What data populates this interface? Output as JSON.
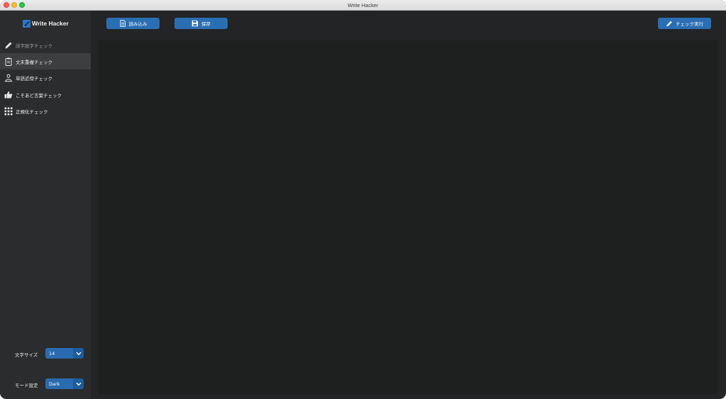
{
  "window": {
    "title": "Write Hacker"
  },
  "app": {
    "logo_text": "Write Hacker"
  },
  "sidebar": {
    "items": [
      {
        "label": "誤字脱字チェック",
        "icon": "pencil-icon",
        "state": "dimmed"
      },
      {
        "label": "文末重複チェック",
        "icon": "clipboard-icon",
        "state": "selected"
      },
      {
        "label": "単語近傍チェック",
        "icon": "people-icon",
        "state": "normal"
      },
      {
        "label": "こそあど言葉チェック",
        "icon": "thumbs-up-icon",
        "state": "normal"
      },
      {
        "label": "正規化チェック",
        "icon": "grid-dots-icon",
        "state": "normal"
      }
    ]
  },
  "settings": {
    "font_size_label": "文字サイズ",
    "font_size_value": "14",
    "mode_label": "モード設定",
    "mode_value": "Dark"
  },
  "toolbar": {
    "load_label": "読み込み",
    "save_label": "保存",
    "run_check_label": "チェック実行"
  },
  "editor": {
    "content": ""
  },
  "colors": {
    "accent": "#2a6eb3",
    "window_bg": "#232425",
    "sidebar_bg": "#2b2c2d",
    "selected_bg": "#3d3e3f",
    "editor_bg": "#1e1f1f"
  }
}
